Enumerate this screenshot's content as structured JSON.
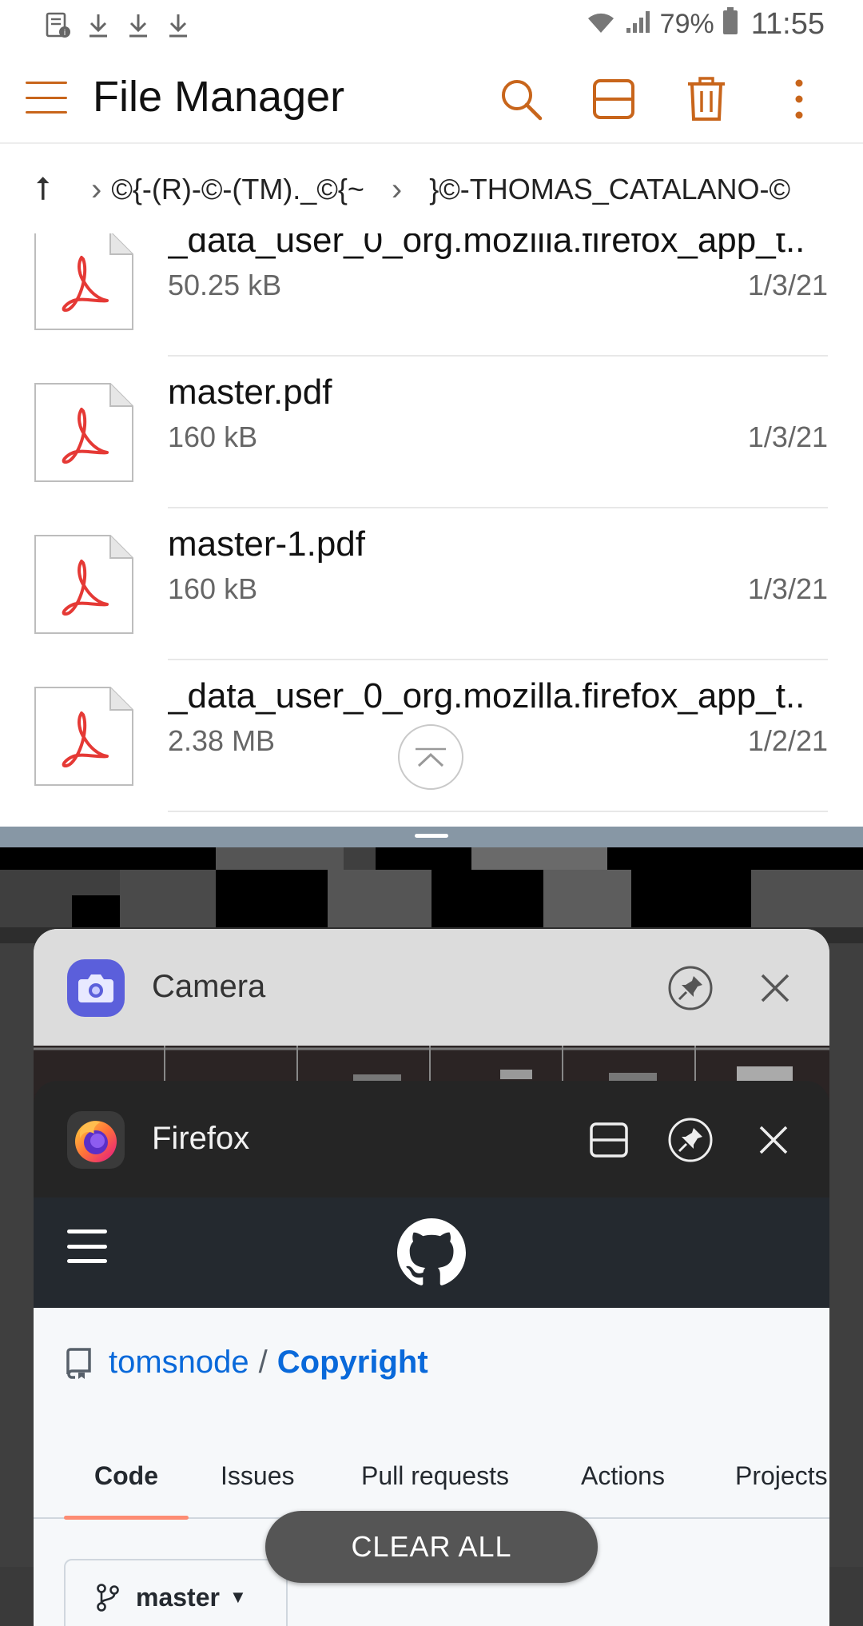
{
  "status_bar": {
    "battery_percent": "79%",
    "time": "11:55",
    "icons": [
      "notification-document-icon",
      "download-icon",
      "download-icon",
      "download-icon",
      "wifi-icon",
      "signal-icon",
      "battery-icon"
    ]
  },
  "app_bar": {
    "title": "File Manager",
    "actions": [
      "search-icon",
      "split-view-icon",
      "delete-icon",
      "more-icon"
    ],
    "accent_color": "#c8651b"
  },
  "breadcrumb": {
    "up_symbol": "⭡",
    "separator": "›",
    "items": [
      "©{-(R)-©-(TM)._©{~",
      "}©-THOMAS_CATALANO-©"
    ]
  },
  "files": [
    {
      "name": "_data_user_0_org.mozilla.firefox_app_t..",
      "size": "50.25 kB",
      "date": "1/3/21"
    },
    {
      "name": "master.pdf",
      "size": "160 kB",
      "date": "1/3/21"
    },
    {
      "name": "master-1.pdf",
      "size": "160 kB",
      "date": "1/3/21"
    },
    {
      "name": "_data_user_0_org.mozilla.firefox_app_t..",
      "size": "2.38 MB",
      "date": "1/2/21"
    }
  ],
  "recents": {
    "camera": {
      "title": "Camera"
    },
    "firefox": {
      "title": "Firefox",
      "github": {
        "owner": "tomsnode",
        "slash": "/",
        "repo": "Copyright",
        "tabs": [
          "Code",
          "Issues",
          "Pull requests",
          "Actions",
          "Projects"
        ],
        "active_tab": "Code",
        "branch": "master"
      }
    },
    "clear_all_label": "CLEAR ALL"
  }
}
